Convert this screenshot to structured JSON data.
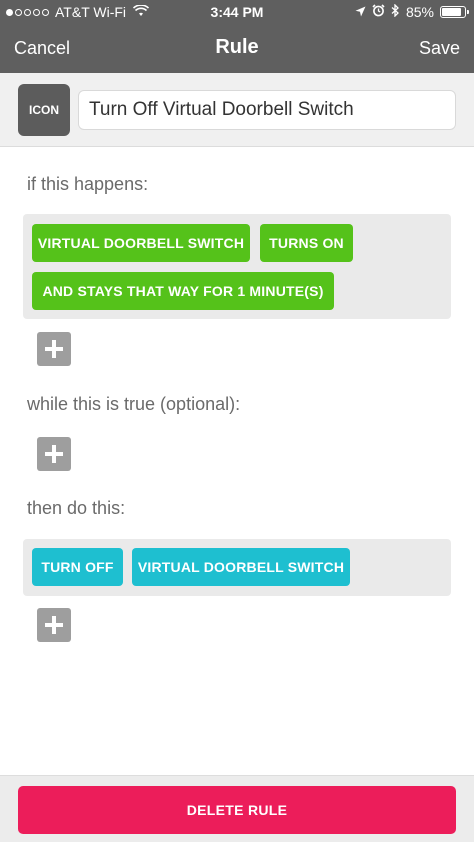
{
  "status_bar": {
    "carrier": "AT&T Wi-Fi",
    "time": "3:44 PM",
    "battery_percent": "85%",
    "battery_level": 0.85,
    "signal_dots_filled": 1,
    "signal_dots_total": 5
  },
  "nav": {
    "cancel_label": "Cancel",
    "title": "Rule",
    "save_label": "Save"
  },
  "rule": {
    "icon_label": "ICON",
    "name_value": "Turn Off Virtual Doorbell Switch"
  },
  "trigger_section": {
    "label": "if this happens:",
    "tags": [
      "VIRTUAL DOORBELL SWITCH",
      "TURNS ON",
      "AND STAYS THAT WAY FOR 1 MINUTE(S)"
    ]
  },
  "condition_section": {
    "label": "while this is true (optional):"
  },
  "action_section": {
    "label": "then do this:",
    "tags": [
      "TURN OFF",
      "VIRTUAL DOORBELL SWITCH"
    ]
  },
  "footer": {
    "delete_label": "DELETE RULE"
  },
  "colors": {
    "topbar": "#5f5f5f",
    "trigger_tag": "#55c21a",
    "action_tag": "#1ebfd0",
    "delete_button": "#ec1d5a",
    "add_button": "#9e9e9e"
  }
}
